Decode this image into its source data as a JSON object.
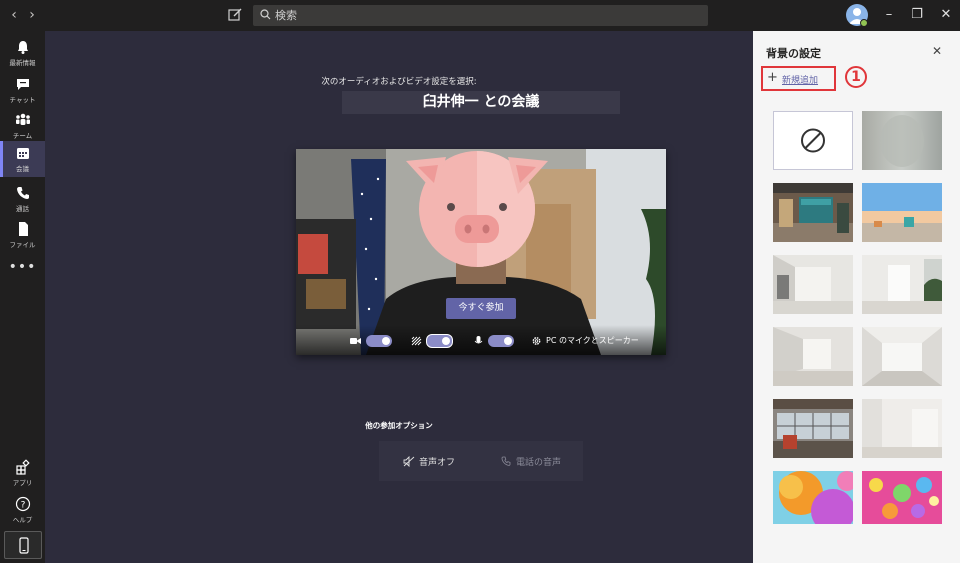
{
  "header": {
    "search_placeholder": "検索"
  },
  "rail": {
    "items": [
      {
        "label": "最新情報"
      },
      {
        "label": "チャット"
      },
      {
        "label": "チーム"
      },
      {
        "label": "会議"
      },
      {
        "label": "通話"
      },
      {
        "label": "ファイル"
      },
      {
        "label": "アプリ"
      },
      {
        "label": "ヘルプ"
      }
    ],
    "more": "•••"
  },
  "stage": {
    "subtitle": "次のオーディオおよびビデオ設定を選択:",
    "meeting_title": "臼井伸一 との会議",
    "join_button": "今すぐ参加",
    "device_label": "PC のマイクとスピーカー",
    "other_options_title": "他の参加オプション",
    "audio_off": "音声オフ",
    "phone_audio": "電話の音声"
  },
  "panel": {
    "title": "背景の設定",
    "add_new": "新規追加",
    "annotation_number": "1",
    "close_icon": "close-icon"
  },
  "colors": {
    "accent": "#6264a7",
    "highlight": "#e0363a",
    "status_online": "#92c353"
  }
}
